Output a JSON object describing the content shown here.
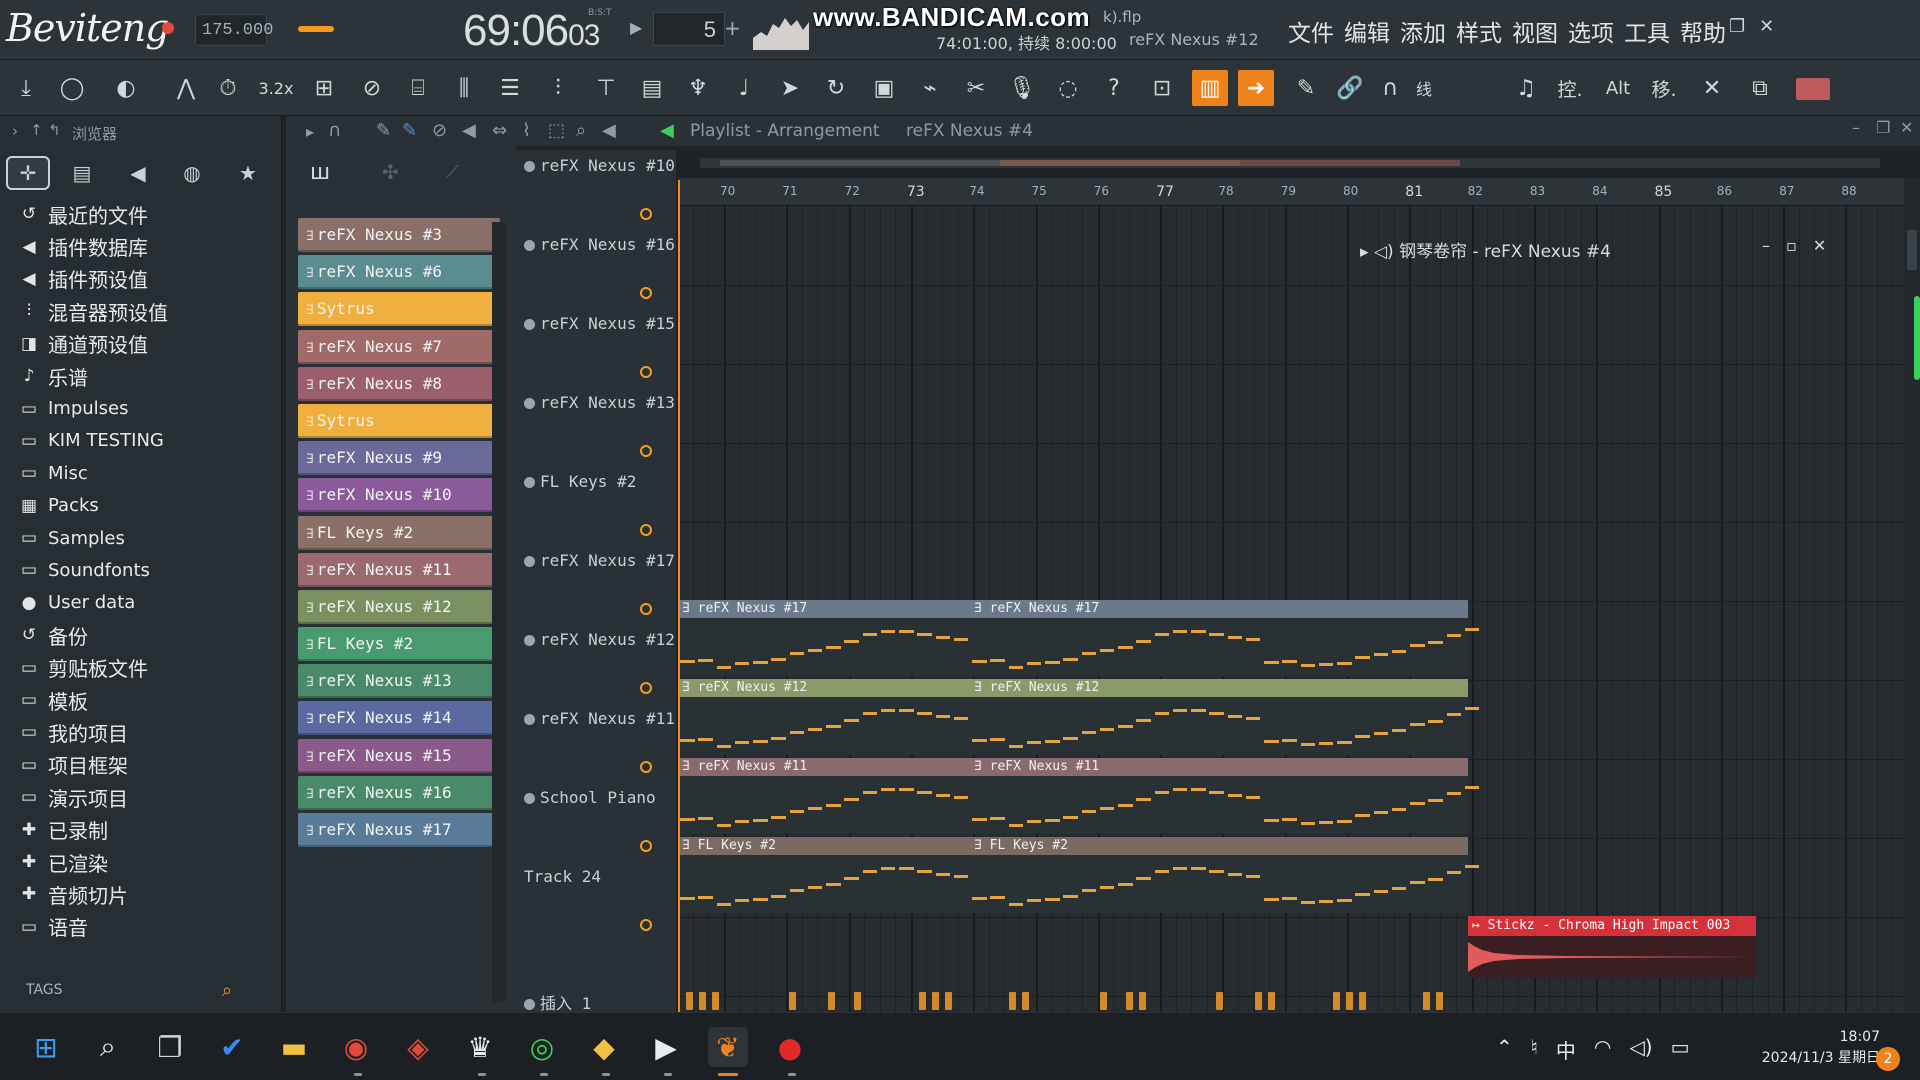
{
  "app": {
    "overlay_name": "Beviteng",
    "tempo": "175.000",
    "clock_main": "69:06",
    "clock_sub": "03",
    "clock_label": "B:S:T",
    "pattern_number": "5",
    "watermark": "www.BANDICAM.com",
    "project_file_suffix": "k).flp",
    "hint_position": "74:01:00,  持续 8:00:00",
    "hint_channel": "reFX Nexus #12",
    "menu": [
      "文件",
      "编辑",
      "添加",
      "样式",
      "视图",
      "选项",
      "工具",
      "帮助"
    ],
    "accent_color": "#f0821a"
  },
  "toolbar": {
    "link_label": "线",
    "alt_label": "Alt",
    "move_label": "移.",
    "ctrl_label": "控.",
    "speed_label": "3.2x"
  },
  "browser": {
    "title": "浏览器",
    "items": [
      {
        "icon": "recent-icon",
        "glyph": "↺",
        "label": "最近的文件"
      },
      {
        "icon": "plugin-db-icon",
        "glyph": "◀",
        "label": "插件数据库"
      },
      {
        "icon": "plugin-preset-icon",
        "glyph": "◀",
        "label": "插件预设值"
      },
      {
        "icon": "mixer-preset-icon",
        "glyph": "⫶",
        "label": "混音器预设值"
      },
      {
        "icon": "channel-preset-icon",
        "glyph": "◨",
        "label": "通道预设值"
      },
      {
        "icon": "music-note-icon",
        "glyph": "♪",
        "label": "乐谱"
      },
      {
        "icon": "folder-icon",
        "glyph": "▭",
        "label": "Impulses"
      },
      {
        "icon": "folder-icon",
        "glyph": "▭",
        "label": "KIM TESTING"
      },
      {
        "icon": "folder-icon",
        "glyph": "▭",
        "label": "Misc"
      },
      {
        "icon": "packs-icon",
        "glyph": "▦",
        "label": "Packs"
      },
      {
        "icon": "folder-icon",
        "glyph": "▭",
        "label": "Samples"
      },
      {
        "icon": "folder-icon",
        "glyph": "▭",
        "label": "Soundfonts"
      },
      {
        "icon": "user-icon",
        "glyph": "●",
        "label": "User data"
      },
      {
        "icon": "backup-icon",
        "glyph": "↺",
        "label": "备份"
      },
      {
        "icon": "folder-icon",
        "glyph": "▭",
        "label": "剪贴板文件"
      },
      {
        "icon": "folder-icon",
        "glyph": "▭",
        "label": "模板"
      },
      {
        "icon": "folder-icon",
        "glyph": "▭",
        "label": "我的项目"
      },
      {
        "icon": "folder-icon",
        "glyph": "▭",
        "label": "项目框架"
      },
      {
        "icon": "folder-icon",
        "glyph": "▭",
        "label": "演示项目"
      },
      {
        "icon": "recorded-icon",
        "glyph": "✚",
        "label": "已录制"
      },
      {
        "icon": "rendered-icon",
        "glyph": "✚",
        "label": "已渲染"
      },
      {
        "icon": "sliced-audio-icon",
        "glyph": "✚",
        "label": "音频切片"
      },
      {
        "icon": "folder-icon",
        "glyph": "▭",
        "label": "语音"
      }
    ],
    "tags_label": "TAGS"
  },
  "channels": [
    {
      "label": "reFX Nexus #3",
      "color": "#8a7068"
    },
    {
      "label": "reFX Nexus #6",
      "color": "#5a8c90"
    },
    {
      "label": "Sytrus",
      "color": "#f0b040"
    },
    {
      "label": "reFX Nexus #7",
      "color": "#a06a68"
    },
    {
      "label": "reFX Nexus #8",
      "color": "#9a5e6c"
    },
    {
      "label": "Sytrus",
      "color": "#f0b040"
    },
    {
      "label": "reFX Nexus #9",
      "color": "#6a6a9a"
    },
    {
      "label": "reFX Nexus #10",
      "color": "#8a5a9a"
    },
    {
      "label": "FL Keys #2",
      "color": "#8a7066"
    },
    {
      "label": "reFX Nexus #11",
      "color": "#9a6a70"
    },
    {
      "label": "reFX Nexus #12",
      "color": "#7a9060"
    },
    {
      "label": "FL Keys #2",
      "color": "#4a9a70"
    },
    {
      "label": "reFX Nexus #13",
      "color": "#4a8a6a"
    },
    {
      "label": "reFX Nexus #14",
      "color": "#5a6aa0"
    },
    {
      "label": "reFX Nexus #15",
      "color": "#8a5a8a"
    },
    {
      "label": "reFX Nexus #16",
      "color": "#4a8a6a"
    },
    {
      "label": "reFX Nexus #17",
      "color": "#5a7a9a"
    }
  ],
  "playlist": {
    "title": "Playlist - Arrangement",
    "pattern": "reFX Nexus #4",
    "tracks": [
      {
        "label": "reFX Nexus #10"
      },
      {
        "label": "reFX Nexus #16"
      },
      {
        "label": "reFX Nexus #15"
      },
      {
        "label": "reFX Nexus #13"
      },
      {
        "label": "FL Keys #2"
      },
      {
        "label": "reFX Nexus #17"
      },
      {
        "label": "reFX Nexus #12"
      },
      {
        "label": "reFX Nexus #11"
      },
      {
        "label": "School Piano"
      },
      {
        "label": "Track 24"
      },
      {
        "label": "插入 1"
      }
    ],
    "bar_numbers": [
      "70",
      "71",
      "72",
      "73",
      "74",
      "75",
      "76",
      "77",
      "78",
      "79",
      "80",
      "81",
      "82",
      "83",
      "84",
      "85",
      "86",
      "87",
      "88"
    ],
    "clips": [
      {
        "row": 5,
        "label": "reFX Nexus #17",
        "color": "#6a7a8a"
      },
      {
        "row": 6,
        "label": "reFX Nexus #12",
        "color": "#8a9a68"
      },
      {
        "row": 7,
        "label": "reFX Nexus #11",
        "color": "#8a6a6c"
      },
      {
        "row": 8,
        "label": "FL Keys #2",
        "color": "#7a6a62"
      }
    ],
    "sample_clip": {
      "label": "Stickz - Chroma High Impact 003",
      "color": "#d6303a"
    },
    "piano_roll_title": "钢琴卷帘 - reFX Nexus #4"
  },
  "taskbar": {
    "time": "18:07",
    "date": "2024/11/3 星期日",
    "ime": "中",
    "notification_count": "2"
  }
}
